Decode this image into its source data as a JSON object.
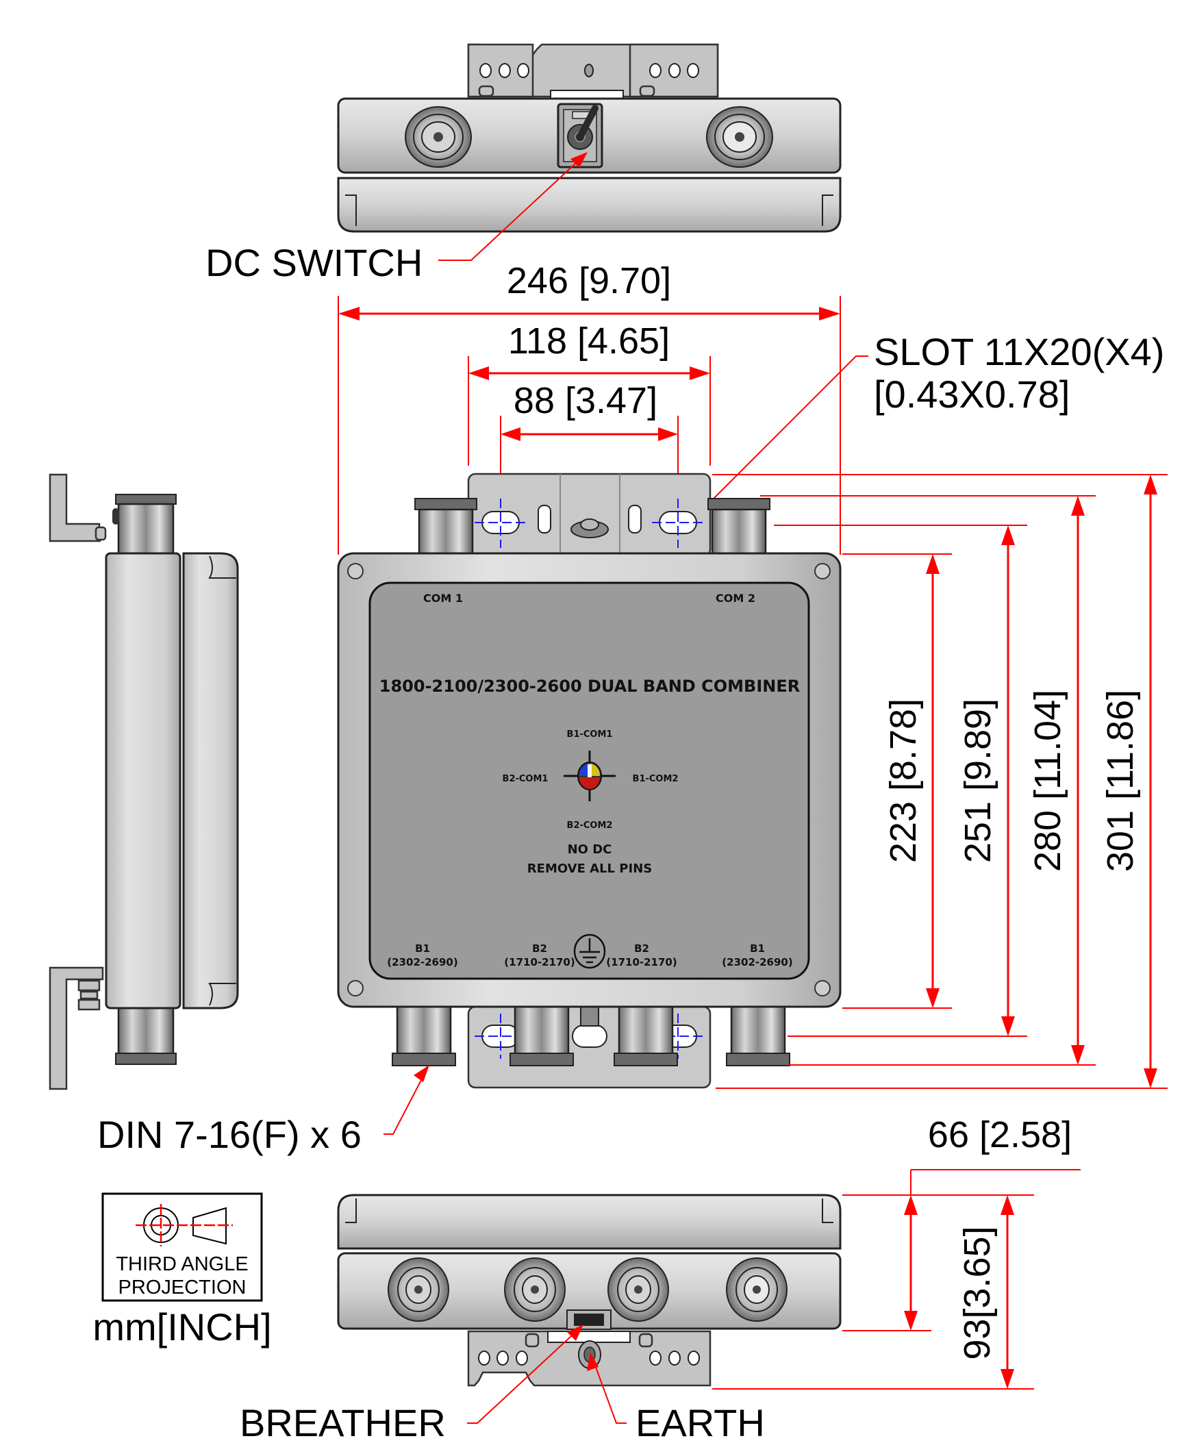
{
  "drawing": {
    "projection_box": {
      "line1": "THIRD ANGLE",
      "line2": "PROJECTION"
    },
    "units_label": "mm[INCH]",
    "callouts": {
      "dc_switch": "DC SWITCH",
      "slot_line1": "SLOT 11X20(X4)",
      "slot_line2": "[0.43X0.78]",
      "din_connectors": "DIN 7-16(F) x 6",
      "breather": "BREATHER",
      "earth": "EARTH"
    },
    "dimensions": {
      "overall_width": "246 [9.70]",
      "bracket_width": "118 [4.65]",
      "slot_spacing": "88 [3.47]",
      "body_height": "223 [8.78]",
      "height_251": "251 [9.89]",
      "height_280": "280 [11.04]",
      "overall_height": "301 [11.86]",
      "body_depth": "66 [2.58]",
      "overall_depth": "93[3.65]"
    },
    "label_panel": {
      "com1": "COM 1",
      "com2": "COM 2",
      "title": "1800-2100/2300-2600 DUAL BAND COMBINER",
      "diagram": {
        "top": "B1-COM1",
        "left": "B2-COM1",
        "right": "B1-COM2",
        "bottom": "B2-COM2",
        "colors": {
          "blue": "#1f3fd6",
          "yellow": "#d4c21a",
          "red": "#c41a12"
        }
      },
      "warning_line1": "NO DC",
      "warning_line2": "REMOVE ALL PINS",
      "ports": [
        {
          "band": "B1",
          "range": "(2302-2690)"
        },
        {
          "band": "B2",
          "range": "(1710-2170)"
        },
        {
          "band": "B2",
          "range": "(1710-2170)"
        },
        {
          "band": "B1",
          "range": "(2302-2690)"
        }
      ]
    },
    "colors": {
      "dimension_red": "#ff0000",
      "centerline_blue": "#1a1aff",
      "panel_gray": "#9b9b9b"
    }
  }
}
